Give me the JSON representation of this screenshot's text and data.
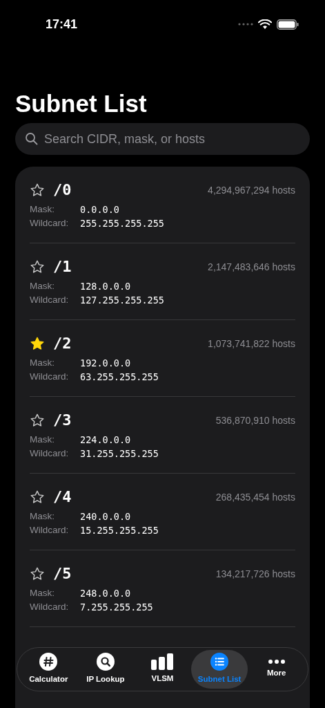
{
  "status_bar": {
    "time": "17:41"
  },
  "title": "Subnet List",
  "search": {
    "placeholder": "Search CIDR, mask, or hosts"
  },
  "subnets": [
    {
      "cidr": "/0",
      "hosts": "4,294,967,294 hosts",
      "mask_label": "Mask:",
      "mask": "0.0.0.0",
      "wildcard_label": "Wildcard:",
      "wildcard": "255.255.255.255",
      "favorite": false
    },
    {
      "cidr": "/1",
      "hosts": "2,147,483,646 hosts",
      "mask_label": "Mask:",
      "mask": "128.0.0.0",
      "wildcard_label": "Wildcard:",
      "wildcard": "127.255.255.255",
      "favorite": false
    },
    {
      "cidr": "/2",
      "hosts": "1,073,741,822 hosts",
      "mask_label": "Mask:",
      "mask": "192.0.0.0",
      "wildcard_label": "Wildcard:",
      "wildcard": "63.255.255.255",
      "favorite": true
    },
    {
      "cidr": "/3",
      "hosts": "536,870,910 hosts",
      "mask_label": "Mask:",
      "mask": "224.0.0.0",
      "wildcard_label": "Wildcard:",
      "wildcard": "31.255.255.255",
      "favorite": false
    },
    {
      "cidr": "/4",
      "hosts": "268,435,454 hosts",
      "mask_label": "Mask:",
      "mask": "240.0.0.0",
      "wildcard_label": "Wildcard:",
      "wildcard": "15.255.255.255",
      "favorite": false
    },
    {
      "cidr": "/5",
      "hosts": "134,217,726 hosts",
      "mask_label": "Mask:",
      "mask": "248.0.0.0",
      "wildcard_label": "Wildcard:",
      "wildcard": "7.255.255.255",
      "favorite": false
    }
  ],
  "tabs": [
    {
      "kind": "hash",
      "label": "Calculator",
      "selected": false
    },
    {
      "kind": "magnifier",
      "label": "IP Lookup",
      "selected": false
    },
    {
      "kind": "bars",
      "label": "VLSM",
      "selected": false
    },
    {
      "kind": "list",
      "label": "Subnet List",
      "selected": true
    },
    {
      "kind": "dots",
      "label": "More",
      "selected": false
    }
  ]
}
